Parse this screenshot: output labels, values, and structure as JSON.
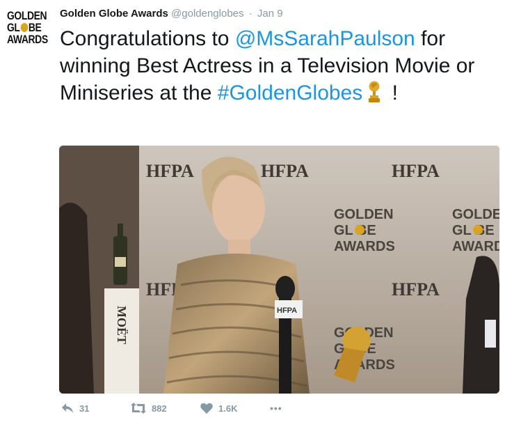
{
  "avatar": {
    "lines": [
      "GOLDEN",
      "GL",
      "BE",
      "AWARDS"
    ]
  },
  "tweet": {
    "display_name": "Golden Globe Awards",
    "handle": "@goldenglobes",
    "separator": "·",
    "date": "Jan 9",
    "text_1": "Congratulations to ",
    "mention": "@MsSarahPaulson",
    "text_2": " for winning Best Actress in a Television Movie or Miniseries at the ",
    "hashtag": "#GoldenGlobes",
    "text_3": " !"
  },
  "media": {
    "backdrop_logo": "HFPA",
    "backdrop_golden": "GOLDEN",
    "backdrop_globe": "GL  BE",
    "backdrop_awards": "AWARDS",
    "bottle_label": "MOËT",
    "mic_flag": "HFPA"
  },
  "actions": {
    "reply_count": "31",
    "retweet_count": "882",
    "like_count": "1.6K",
    "more_label": "•••"
  },
  "colors": {
    "link": "#1b95e0",
    "meta_gray": "#8899a6",
    "gold": "#d9a521"
  },
  "icons": [
    "reply-icon",
    "retweet-icon",
    "heart-icon",
    "more-icon",
    "trophy-emoji-icon"
  ]
}
